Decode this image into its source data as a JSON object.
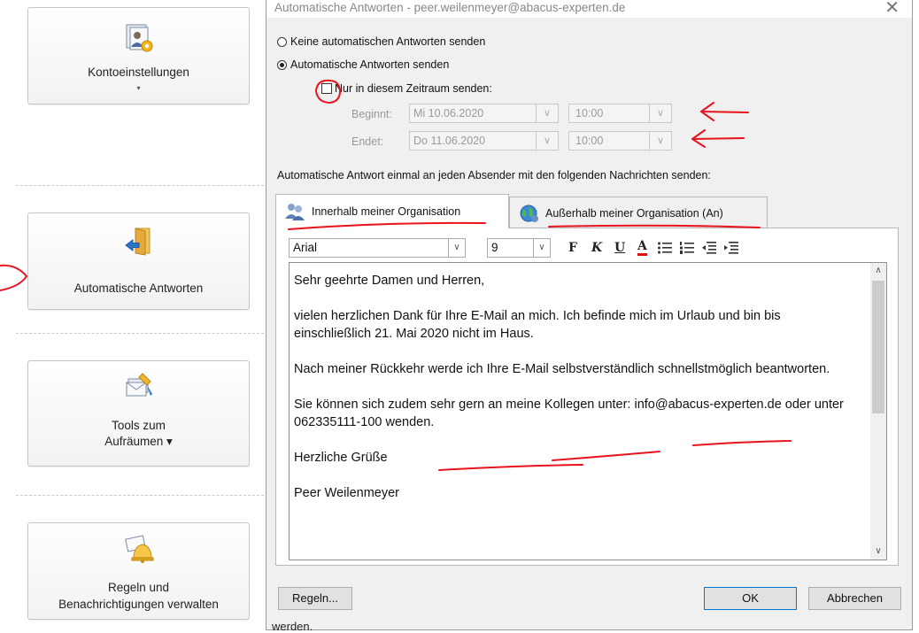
{
  "backstage": {
    "account_settings": {
      "label": "Kontoeinstellungen",
      "caret": "▾"
    },
    "auto_replies": {
      "label": "Automatische Antworten"
    },
    "cleanup_tools": {
      "label_line1": "Tools zum",
      "label_line2": "Aufräumen ▾"
    },
    "rules": {
      "label_line1": "Regeln und",
      "label_line2": "Benachrichtigungen verwalten"
    }
  },
  "dialog": {
    "title": "Automatische Antworten - peer.weilenmeyer@abacus-experten.de",
    "close_glyph": "✕",
    "radio_no": "Keine automatischen Antworten senden",
    "radio_yes": "Automatische Antworten senden",
    "checkbox_range": "Nur in diesem Zeitraum senden:",
    "start_label": "Beginnt:",
    "start_date": "Mi 10.06.2020",
    "start_time": "10:00",
    "end_label": "Endet:",
    "end_date": "Do 11.06.2020",
    "end_time": "10:00",
    "send_once_label": "Automatische Antwort einmal an jeden Absender mit den folgenden Nachrichten senden:",
    "tab_inside": "Innerhalb meiner Organisation",
    "tab_outside": "Außerhalb meiner Organisation (An)",
    "font_name": "Arial",
    "font_size": "9",
    "format_bold": "F",
    "format_italic": "K",
    "format_underline": "U",
    "format_color": "A",
    "message": {
      "p1": "Sehr geehrte Damen und Herren,",
      "p2": "vielen herzlichen Dank für Ihre E-Mail an mich. Ich befinde mich im Urlaub und bin bis einschließlich 21. Mai 2020 nicht im Haus.",
      "p3": "Nach meiner Rückkehr werde ich Ihre E-Mail selbstverständlich schnellstmöglich beantworten.",
      "p4": "Sie können sich zudem sehr gern an meine Kollegen unter: info@abacus-experten.de oder unter 062335111-100 wenden.",
      "p5": "Herzliche Grüße",
      "p6": "Peer Weilenmeyer"
    },
    "rules_button": "Regeln...",
    "ok_button": "OK",
    "cancel_button": "Abbrechen",
    "footer_text": "werden."
  },
  "colors": {
    "annotation": "#e8141d",
    "accent": "#0078d7",
    "color_underline": "#dd1111"
  }
}
